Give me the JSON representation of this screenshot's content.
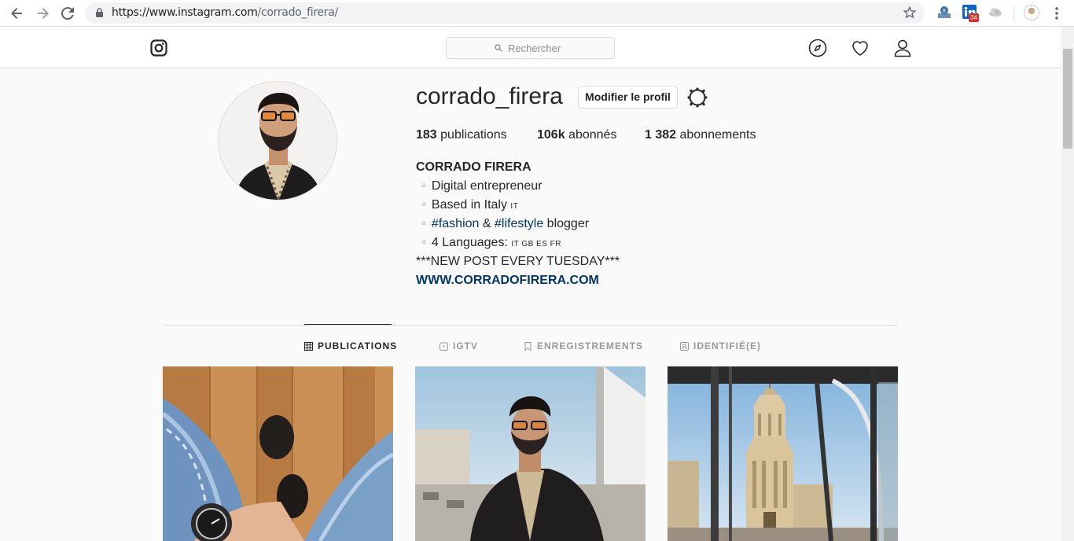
{
  "browser": {
    "url_domain": "https://www.instagram.com",
    "url_path": "/corrado_firera/",
    "ext_badge": "34"
  },
  "header": {
    "search_placeholder": "Rechercher"
  },
  "profile": {
    "username": "corrado_firera",
    "edit_button": "Modifier le profil",
    "stats": {
      "posts_count": "183",
      "posts_label": "publications",
      "followers_count": "106k",
      "followers_label": "abonnés",
      "following_count": "1 382",
      "following_label": "abonnements"
    },
    "bio": {
      "name": "CORRADO FIRERA",
      "line1": "▫️Digital entrepreneur",
      "line2_text": "▫️Based in Italy ",
      "line2_flag": "IT",
      "line3_prefix": "▫️",
      "line3_hash1": "#fashion",
      "line3_mid": " & ",
      "line3_hash2": "#lifestyle",
      "line3_suffix": " blogger",
      "line4_text": "▫️4 Languages: ",
      "line4_flags": "IT GB ES FR",
      "line5": "***NEW POST EVERY TUESDAY***",
      "website": "WWW.CORRADOFIRERA.COM"
    }
  },
  "tabs": [
    {
      "label": "PUBLICATIONS",
      "active": true
    },
    {
      "label": "IGTV",
      "active": false
    },
    {
      "label": "ENREGISTREMENTS",
      "active": false
    },
    {
      "label": "IDENTIFIÉ(E)",
      "active": false
    }
  ],
  "colors": {
    "link": "#003569",
    "text": "#262626",
    "muted": "#999999",
    "border": "#dbdbdb"
  }
}
